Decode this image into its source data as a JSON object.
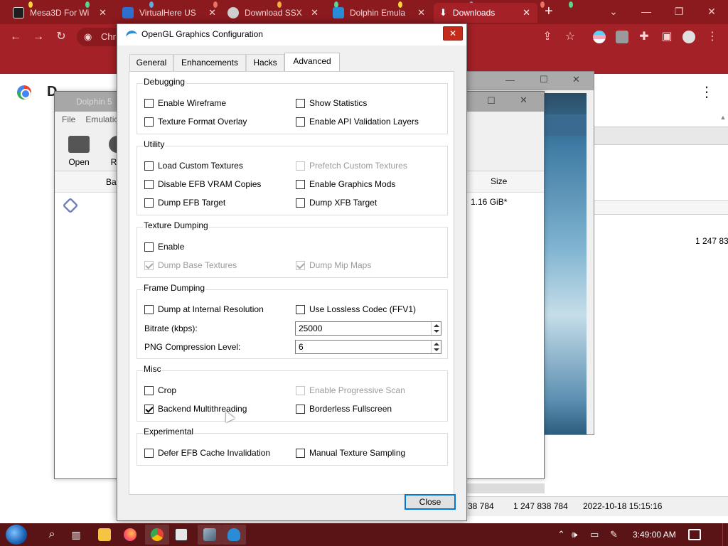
{
  "browser": {
    "tabs": [
      {
        "label": "Mesa3D For Wi",
        "fav_color": "#1e1e1e"
      },
      {
        "label": "VirtualHere US",
        "fav_color": "#2f6fd0"
      },
      {
        "label": "Download SSX",
        "fav_color": "#cfcfcf"
      },
      {
        "label": "Dolphin Emula",
        "fav_color": "#2a8bd6"
      },
      {
        "label": "Downloads",
        "fav_color": "#ffffff"
      }
    ],
    "new_tab": "+",
    "omnibox_text": "Chr",
    "page_title": "D",
    "menu": "⋮"
  },
  "dolphin_main": {
    "title": "Dolphin 5",
    "menu": [
      "File",
      "Emulatio"
    ],
    "toolbar": [
      {
        "label": "Open"
      },
      {
        "label": "Ref"
      }
    ],
    "column_partial": "Ba",
    "size_header": "Size",
    "size_value": "1.16 GiB*"
  },
  "background_values": {
    "partial_size": "1 247 838",
    "status_a": "38 784",
    "status_b": "1 247 838 784",
    "status_date": "2022-10-18 15:15:16"
  },
  "dialog": {
    "title": "OpenGL Graphics Configuration",
    "close_x": "✕",
    "tabs": [
      "General",
      "Enhancements",
      "Hacks",
      "Advanced"
    ],
    "selected_tab": "Advanced",
    "groups": {
      "debugging": {
        "label": "Debugging",
        "items": [
          {
            "label": "Enable Wireframe",
            "checked": false,
            "enabled": true
          },
          {
            "label": "Show Statistics",
            "checked": false,
            "enabled": true
          },
          {
            "label": "Texture Format Overlay",
            "checked": false,
            "enabled": true
          },
          {
            "label": "Enable API Validation Layers",
            "checked": false,
            "enabled": true
          }
        ]
      },
      "utility": {
        "label": "Utility",
        "items": [
          {
            "label": "Load Custom Textures",
            "checked": false,
            "enabled": true
          },
          {
            "label": "Prefetch Custom Textures",
            "checked": false,
            "enabled": false
          },
          {
            "label": "Disable EFB VRAM Copies",
            "checked": false,
            "enabled": true
          },
          {
            "label": "Enable Graphics Mods",
            "checked": false,
            "enabled": true
          },
          {
            "label": "Dump EFB Target",
            "checked": false,
            "enabled": true
          },
          {
            "label": "Dump XFB Target",
            "checked": false,
            "enabled": true
          }
        ]
      },
      "texture_dumping": {
        "label": "Texture Dumping",
        "items": [
          {
            "label": "Enable",
            "checked": false,
            "enabled": true
          },
          {
            "label": "Dump Base Textures",
            "checked": true,
            "enabled": false
          },
          {
            "label": "Dump Mip Maps",
            "checked": true,
            "enabled": false
          }
        ]
      },
      "frame_dumping": {
        "label": "Frame Dumping",
        "items": [
          {
            "label": "Dump at Internal Resolution",
            "checked": false,
            "enabled": true
          },
          {
            "label": "Use Lossless Codec (FFV1)",
            "checked": false,
            "enabled": true
          }
        ],
        "bitrate_label": "Bitrate (kbps):",
        "bitrate_value": "25000",
        "png_label": "PNG Compression Level:",
        "png_value": "6"
      },
      "misc": {
        "label": "Misc",
        "items": [
          {
            "label": "Crop",
            "checked": false,
            "enabled": true
          },
          {
            "label": "Enable Progressive Scan",
            "checked": false,
            "enabled": false
          },
          {
            "label": "Backend Multithreading",
            "checked": true,
            "enabled": true
          },
          {
            "label": "Borderless Fullscreen",
            "checked": false,
            "enabled": true
          }
        ]
      },
      "experimental": {
        "label": "Experimental",
        "items": [
          {
            "label": "Defer EFB Cache Invalidation",
            "checked": false,
            "enabled": true
          },
          {
            "label": "Manual Texture Sampling",
            "checked": false,
            "enabled": true
          }
        ]
      }
    },
    "close_button": "Close"
  },
  "taskbar": {
    "clock": "3:49:00 AM",
    "pinned": [
      "search-icon",
      "task-view-icon",
      "file-explorer-icon",
      "firefox-icon",
      "chrome-icon",
      "7zip-icon",
      "photo-icon",
      "dolphin-icon"
    ]
  },
  "colors": {
    "browser_frame": "#a32127",
    "browser_tabstrip": "#8b1a1f",
    "dialog_close": "#c42b1c",
    "focus_blue": "#0078d7",
    "taskbar": "#5a1416"
  }
}
